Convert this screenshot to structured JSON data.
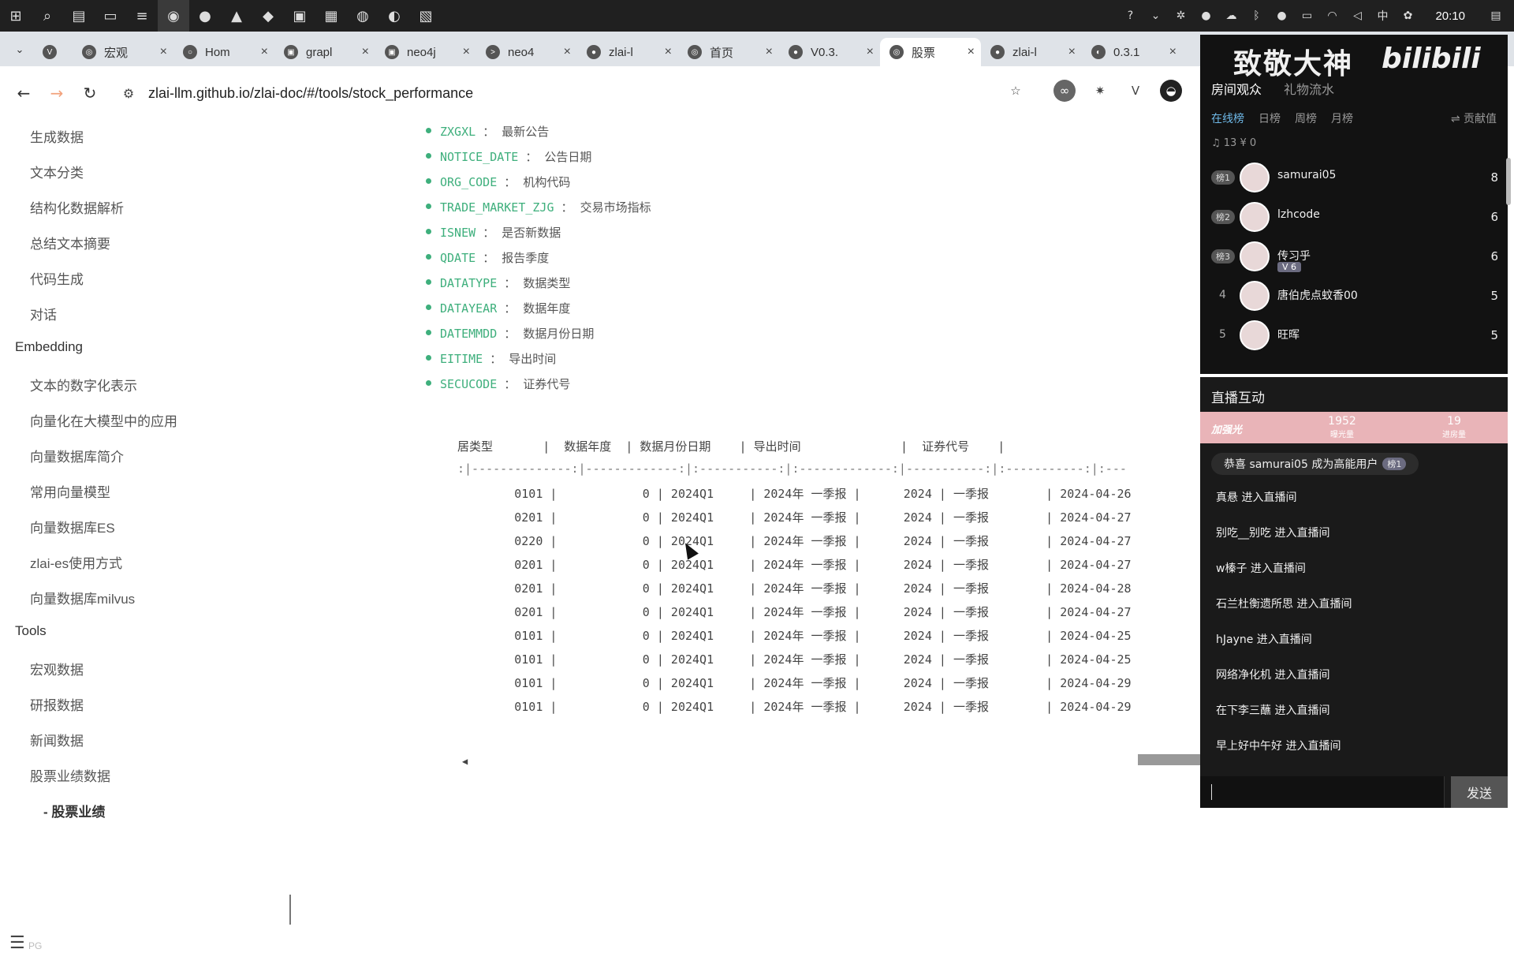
{
  "taskbar": {
    "icons": [
      "windows-start",
      "search",
      "task-view",
      "file-explorer",
      "terminal",
      "chrome",
      "wechat",
      "app",
      "vscode",
      "app2",
      "app3",
      "app4",
      "app5"
    ],
    "clock": "20:10",
    "ime": "中"
  },
  "browser": {
    "tabs": [
      {
        "label": "",
        "favicon": "V"
      },
      {
        "label": "宏观",
        "favicon": "◎"
      },
      {
        "label": "Hom",
        "favicon": "○"
      },
      {
        "label": "grapl",
        "favicon": "▣"
      },
      {
        "label": "neo4j",
        "favicon": "▣"
      },
      {
        "label": "neo4",
        "favicon": ">"
      },
      {
        "label": "zlai-l",
        "favicon": "●"
      },
      {
        "label": "首页",
        "favicon": "◎"
      },
      {
        "label": "V0.3.",
        "favicon": "●"
      },
      {
        "label": "股票",
        "favicon": "◎"
      },
      {
        "label": "zlai-l",
        "favicon": "●"
      },
      {
        "label": "0.3.1",
        "favicon": "◐"
      }
    ],
    "active_tab_index": 9,
    "url": "zlai-llm.github.io/zlai-doc/#/tools/stock_performance"
  },
  "sidebar": {
    "items_top": [
      "生成数据",
      "文本分类",
      "结构化数据解析",
      "总结文本摘要",
      "代码生成",
      "对话"
    ],
    "section_embedding": "Embedding",
    "items_embedding": [
      "文本的数字化表示",
      "向量化在大模型中的应用",
      "向量数据库简介",
      "常用向量模型",
      "向量数据库ES",
      "zlai-es使用方式",
      "向量数据库milvus"
    ],
    "section_tools": "Tools",
    "items_tools": [
      "宏观数据",
      "研报数据",
      "新闻数据",
      "股票业绩数据"
    ],
    "active_sub": "- 股票业绩",
    "footer_tag": "PG"
  },
  "content": {
    "fields": [
      {
        "code": "ZXGXL",
        "sep": "：",
        "desc": "最新公告"
      },
      {
        "code": "NOTICE_DATE",
        "sep": "：",
        "desc": "公告日期"
      },
      {
        "code": "ORG_CODE",
        "sep": "：",
        "desc": "机构代码"
      },
      {
        "code": "TRADE_MARKET_ZJG",
        "sep": "：",
        "desc": "交易市场指标"
      },
      {
        "code": "ISNEW",
        "sep": "：",
        "desc": "是否新数据"
      },
      {
        "code": "QDATE",
        "sep": "：",
        "desc": "报告季度"
      },
      {
        "code": "DATATYPE",
        "sep": "：",
        "desc": "数据类型"
      },
      {
        "code": "DATAYEAR",
        "sep": "：",
        "desc": "数据年度"
      },
      {
        "code": "DATEMMDD",
        "sep": "：",
        "desc": "数据月份日期"
      },
      {
        "code": "EITIME",
        "sep": "：",
        "desc": "导出时间"
      },
      {
        "code": "SECUCODE",
        "sep": "：",
        "desc": "证券代号"
      }
    ],
    "table_header": "居类型       |  数据年度  | 数据月份日期    | 导出时间              |  证券代号    |",
    "table_sep": ":|--------------:|-------------:|:-----------:|:-------------:|-----------:|:-----------:|:---",
    "table_rows": [
      "        0101 |            0 | 2024Q1     | 2024年 一季报 |      2024 | 一季报        | 2024-04-26",
      "        0201 |            0 | 2024Q1     | 2024年 一季报 |      2024 | 一季报        | 2024-04-27",
      "        0220 |            0 | 2024Q1     | 2024年 一季报 |      2024 | 一季报        | 2024-04-27",
      "        0201 |            0 | 2024Q1     | 2024年 一季报 |      2024 | 一季报        | 2024-04-27",
      "        0201 |            0 | 2024Q1     | 2024年 一季报 |      2024 | 一季报        | 2024-04-28",
      "        0201 |            0 | 2024Q1     | 2024年 一季报 |      2024 | 一季报        | 2024-04-27",
      "        0101 |            0 | 2024Q1     | 2024年 一季报 |      2024 | 一季报        | 2024-04-25",
      "        0101 |            0 | 2024Q1     | 2024年 一季报 |      2024 | 一季报        | 2024-04-25",
      "        0101 |            0 | 2024Q1     | 2024年 一季报 |      2024 | 一季报        | 2024-04-29",
      "        0101 |            0 | 2024Q1     | 2024年 一季报 |      2024 | 一季报        | 2024-04-29"
    ]
  },
  "bili": {
    "brand": "致敬大神",
    "logo": "bilibili",
    "tabs": [
      "房间观众",
      "礼物流水"
    ],
    "subtabs": [
      "在线榜",
      "日榜",
      "周榜",
      "月榜"
    ],
    "contrib": "⇌ 贡献值",
    "counts": "♫ 13  ¥ 0",
    "ranking": [
      {
        "badge": "榜1",
        "name": "samurai05",
        "score": "8",
        "fan": ""
      },
      {
        "badge": "榜2",
        "name": "lzhcode",
        "score": "6",
        "fan": ""
      },
      {
        "badge": "榜3",
        "name": "传习乎",
        "score": "6",
        "fan": "V 6"
      },
      {
        "badge": "4",
        "name": "唐伯虎点蚊香00",
        "score": "5",
        "fan": ""
      },
      {
        "badge": "5",
        "name": "旺晖",
        "score": "5",
        "fan": ""
      }
    ],
    "interact_title": "直播互动",
    "join_badge": "加强光",
    "stat1": {
      "value": "1952",
      "label": "曝光量"
    },
    "stat2": {
      "value": "19",
      "label": "进房量"
    },
    "congrats": "恭喜 samurai05 成为高能用户",
    "congrats_badge": "榜1",
    "messages": [
      "真悬 进入直播间",
      "别吃__别吃 进入直播间",
      "w榛子 进入直播间",
      "石兰杜衡遗所思 进入直播间",
      "hJayne 进入直播间",
      "网络净化机 进入直播间",
      "在下李三蘸 进入直播间",
      "早上好中午好 进入直播间"
    ],
    "send_label": "发送"
  }
}
